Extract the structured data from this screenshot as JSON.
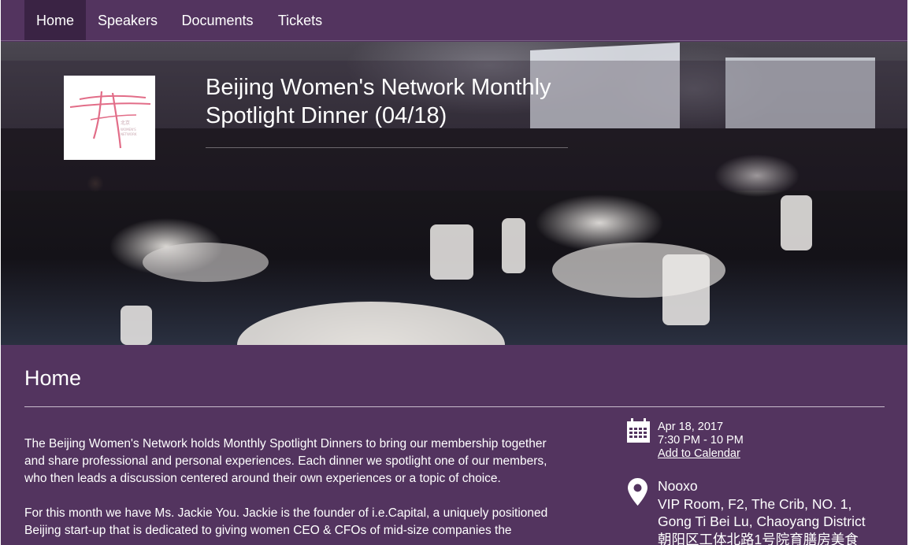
{
  "nav": {
    "items": [
      {
        "label": "Home",
        "active": true
      },
      {
        "label": "Speakers",
        "active": false
      },
      {
        "label": "Documents",
        "active": false
      },
      {
        "label": "Tickets",
        "active": false
      }
    ]
  },
  "hero": {
    "title_line1": "Beijing Women's Network Monthly",
    "title_line2": "Spotlight Dinner (04/18)",
    "logo_icon": "bwn-logo"
  },
  "main": {
    "page_title": "Home",
    "paragraphs": [
      "The Beijing Women's Network holds Monthly Spotlight Dinners to bring our membership together and share professional and personal experiences. Each dinner we spotlight one of our members, who then leads a discussion centered around their own experiences or a topic of choice.",
      "For this month we have Ms. Jackie You. Jackie is the founder of i.e.Capital, a uniquely positioned Beijing start-up that is dedicated to giving women CEO & CFOs of mid-size companies the"
    ]
  },
  "event_info": {
    "date": "Apr 18, 2017",
    "time": "7:30 PM - 10 PM",
    "add_to_calendar": "Add to Calendar",
    "venue": "Nooxo",
    "address_line1": "VIP Room, F2, The Crib, NO. 1,",
    "address_line2": "Gong Ti Bei Lu, Chaoyang District",
    "address_line3": "朝阳区工体北路1号院育膳房美食",
    "calendar_icon": "calendar-icon",
    "location_icon": "map-pin-icon"
  },
  "colors": {
    "brand_purple": "#53345f",
    "nav_active": "#3a2344",
    "logo_pink": "#e26d88"
  }
}
